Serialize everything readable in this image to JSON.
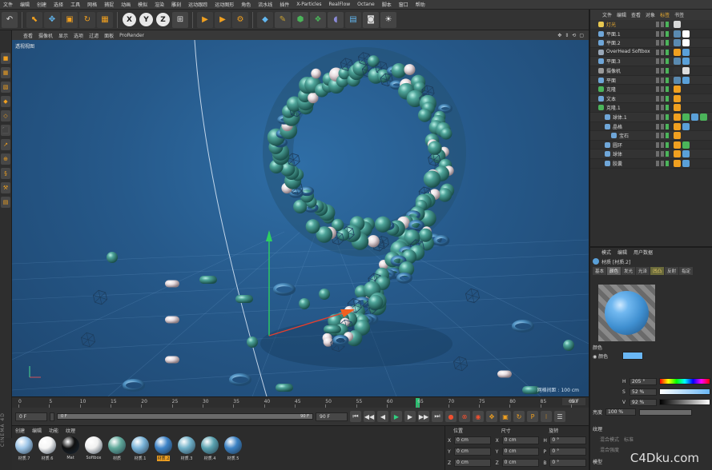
{
  "menubar": [
    "文件",
    "编辑",
    "创建",
    "选择",
    "工具",
    "网格",
    "捕捉",
    "动画",
    "模拟",
    "渲染",
    "雕刻",
    "运动跟踪",
    "运动图形",
    "角色",
    "流水线",
    "插件",
    "X-Particles",
    "RealFlow",
    "Octane",
    "脚本",
    "窗口",
    "帮助"
  ],
  "toolbar": {
    "undo": "↶",
    "axis_x": "X",
    "axis_y": "Y",
    "axis_z": "Z"
  },
  "viewport": {
    "menu": [
      "查看",
      "摄像机",
      "显示",
      "选项",
      "过滤",
      "面板",
      "ProRender"
    ],
    "label": "透视视图",
    "grid_distance": "网格间距 : 100 cm"
  },
  "timeline": {
    "ticks": [
      "0",
      "5",
      "10",
      "15",
      "20",
      "25",
      "30",
      "35",
      "40",
      "45",
      "50",
      "55",
      "60",
      "65",
      "70",
      "75",
      "80",
      "85",
      "90"
    ],
    "current_frame_marker": 65,
    "end_field": "65 F"
  },
  "transport": {
    "start": "0 F",
    "slider_start": "0 F",
    "slider_end": "90 F",
    "end": "90 F"
  },
  "materials": {
    "menu": [
      "创建",
      "编辑",
      "功能",
      "纹理"
    ],
    "items": [
      {
        "label": "材质.7",
        "color": "#9ec6e8",
        "sel": false
      },
      {
        "label": "材质.6",
        "color": "#f5f5f5",
        "sel": false
      },
      {
        "label": "Mat",
        "color": "#111111",
        "sel": false
      },
      {
        "label": "Softbox",
        "color": "#f0f0f0",
        "sel": false
      },
      {
        "label": "材质",
        "color": "#5fa89a",
        "sel": false
      },
      {
        "label": "材质.1",
        "color": "#79b3d8",
        "sel": false
      },
      {
        "label": "材质.2",
        "color": "#3f84c8",
        "sel": true
      },
      {
        "label": "材质.3",
        "color": "#6fb0c8",
        "sel": false
      },
      {
        "label": "材质.4",
        "color": "#5aa2b0",
        "sel": false
      },
      {
        "label": "材质.5",
        "color": "#3c82c4",
        "sel": false
      }
    ]
  },
  "coordinates": {
    "headers": [
      "位置",
      "尺寸",
      "旋转"
    ],
    "rows": [
      {
        "axes": [
          "X",
          "X",
          "H"
        ],
        "vals": [
          "0 cm",
          "0 cm",
          "0 °"
        ]
      },
      {
        "axes": [
          "Y",
          "Y",
          "P"
        ],
        "vals": [
          "0 cm",
          "0 cm",
          "0 °"
        ]
      },
      {
        "axes": [
          "Z",
          "Z",
          "B"
        ],
        "vals": [
          "0 cm",
          "0 cm",
          "0 °"
        ]
      }
    ]
  },
  "object_manager": {
    "menu": [
      "文件",
      "编辑",
      "查看",
      "对象",
      "标签",
      "书签"
    ],
    "objects": [
      {
        "name": "灯光",
        "icon": "#e8c850",
        "hl": true
      },
      {
        "name": "平面.1",
        "icon": "#6fa6d8"
      },
      {
        "name": "平面.2",
        "icon": "#6fa6d8"
      },
      {
        "name": "OverHead Softbox",
        "icon": "#9aa8b8"
      },
      {
        "name": "平面.3",
        "icon": "#6fa6d8"
      },
      {
        "name": "摄像机",
        "icon": "#9a9a9a"
      },
      {
        "name": "平面",
        "icon": "#6fa6d8"
      },
      {
        "name": "克隆",
        "icon": "#4bb45a"
      },
      {
        "name": "文本",
        "icon": "#6fa6d8"
      },
      {
        "name": "克隆.1",
        "icon": "#4bb45a"
      },
      {
        "name": "球体.1",
        "icon": "#6fa6d8"
      },
      {
        "name": "晶格",
        "icon": "#6fa6d8"
      },
      {
        "name": "宝石",
        "icon": "#6fa6d8"
      },
      {
        "name": "圆环",
        "icon": "#6fa6d8"
      },
      {
        "name": "球体",
        "icon": "#6fa6d8"
      },
      {
        "name": "胶囊",
        "icon": "#6fa6d8"
      }
    ]
  },
  "attributes": {
    "menu": [
      "模式",
      "编辑",
      "用户数据"
    ],
    "title": "材质 [材质.2]",
    "tabs": [
      "基本",
      "颜色",
      "发光",
      "光泽",
      "凹凸",
      "反射",
      "指定"
    ],
    "section": "颜色",
    "color_label": "颜色",
    "hsv": [
      {
        "label": "H",
        "value": "205 °"
      },
      {
        "label": "S",
        "value": "52 %"
      },
      {
        "label": "V",
        "value": "92 %"
      }
    ],
    "brightness_label": "亮度",
    "brightness_value": "100 %",
    "texture_label": "纹理",
    "mix_mode_label": "混合模式",
    "mix_mode_value": "标准",
    "mix_strength_label": "混合强度",
    "model_label": "模型"
  },
  "watermark": "C4Dku.com",
  "brand": "CINEMA 4D"
}
